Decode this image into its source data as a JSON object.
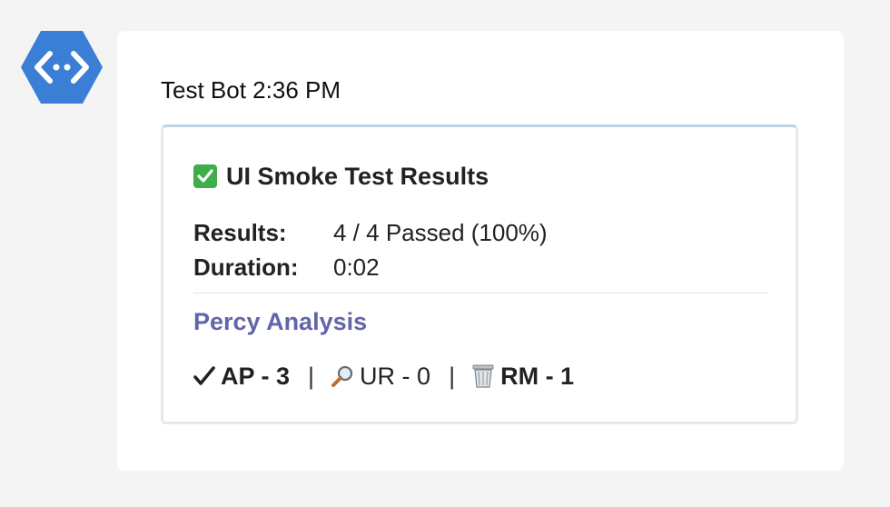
{
  "avatar": {
    "icon": "bot-code-icon",
    "color": "#3a7fd5"
  },
  "message": {
    "sender": "Test Bot",
    "time": "2:36 PM"
  },
  "card": {
    "title": "UI Smoke Test Results",
    "title_icon": "check-mark-button-icon",
    "facts": [
      {
        "key": "Results:",
        "value": "4 / 4 Passed (100%)"
      },
      {
        "key": "Duration:",
        "value": "0:02"
      }
    ],
    "section_title": "Percy Analysis",
    "section_color": "#6265a8",
    "summary": {
      "approved": {
        "icon": "check-mark-icon",
        "text": "AP - 3"
      },
      "unreviewed": {
        "icon": "magnifier-icon",
        "text": "UR - 0"
      },
      "removed": {
        "icon": "wastebasket-icon",
        "text": "RM - 1"
      },
      "separator": "|"
    }
  }
}
